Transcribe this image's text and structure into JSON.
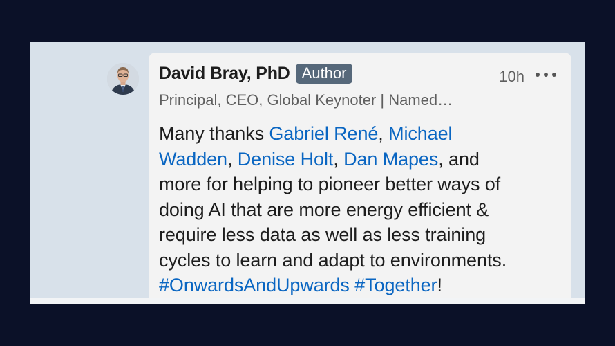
{
  "comment": {
    "author_name": "David Bray, PhD",
    "badge": "Author",
    "timestamp": "10h",
    "headline": "Principal, CEO, Global Keynoter | Named…",
    "body": {
      "t1": "Many thanks ",
      "m1": "Gabriel René",
      "s1": ", ",
      "m2a": "Michael",
      "m2b": "Wadden",
      "s2": ", ",
      "m3": "Denise Holt",
      "s3": ", ",
      "m4": "Dan Mapes",
      "t2": ", and",
      "t3": "more for helping to pioneer better ways of",
      "t4": "doing AI that are more energy efficient &",
      "t5": "require less data as well as less training",
      "t6": "cycles to learn and adapt to environments.",
      "h1": "#OnwardsAndUpwards",
      "s4": " ",
      "h2": "#Together",
      "t7": "!"
    }
  },
  "colors": {
    "link": "#0a66c2",
    "badge_bg": "#56687a",
    "background": "#0b1128"
  },
  "icons": {
    "more": "more-horizontal-icon"
  }
}
